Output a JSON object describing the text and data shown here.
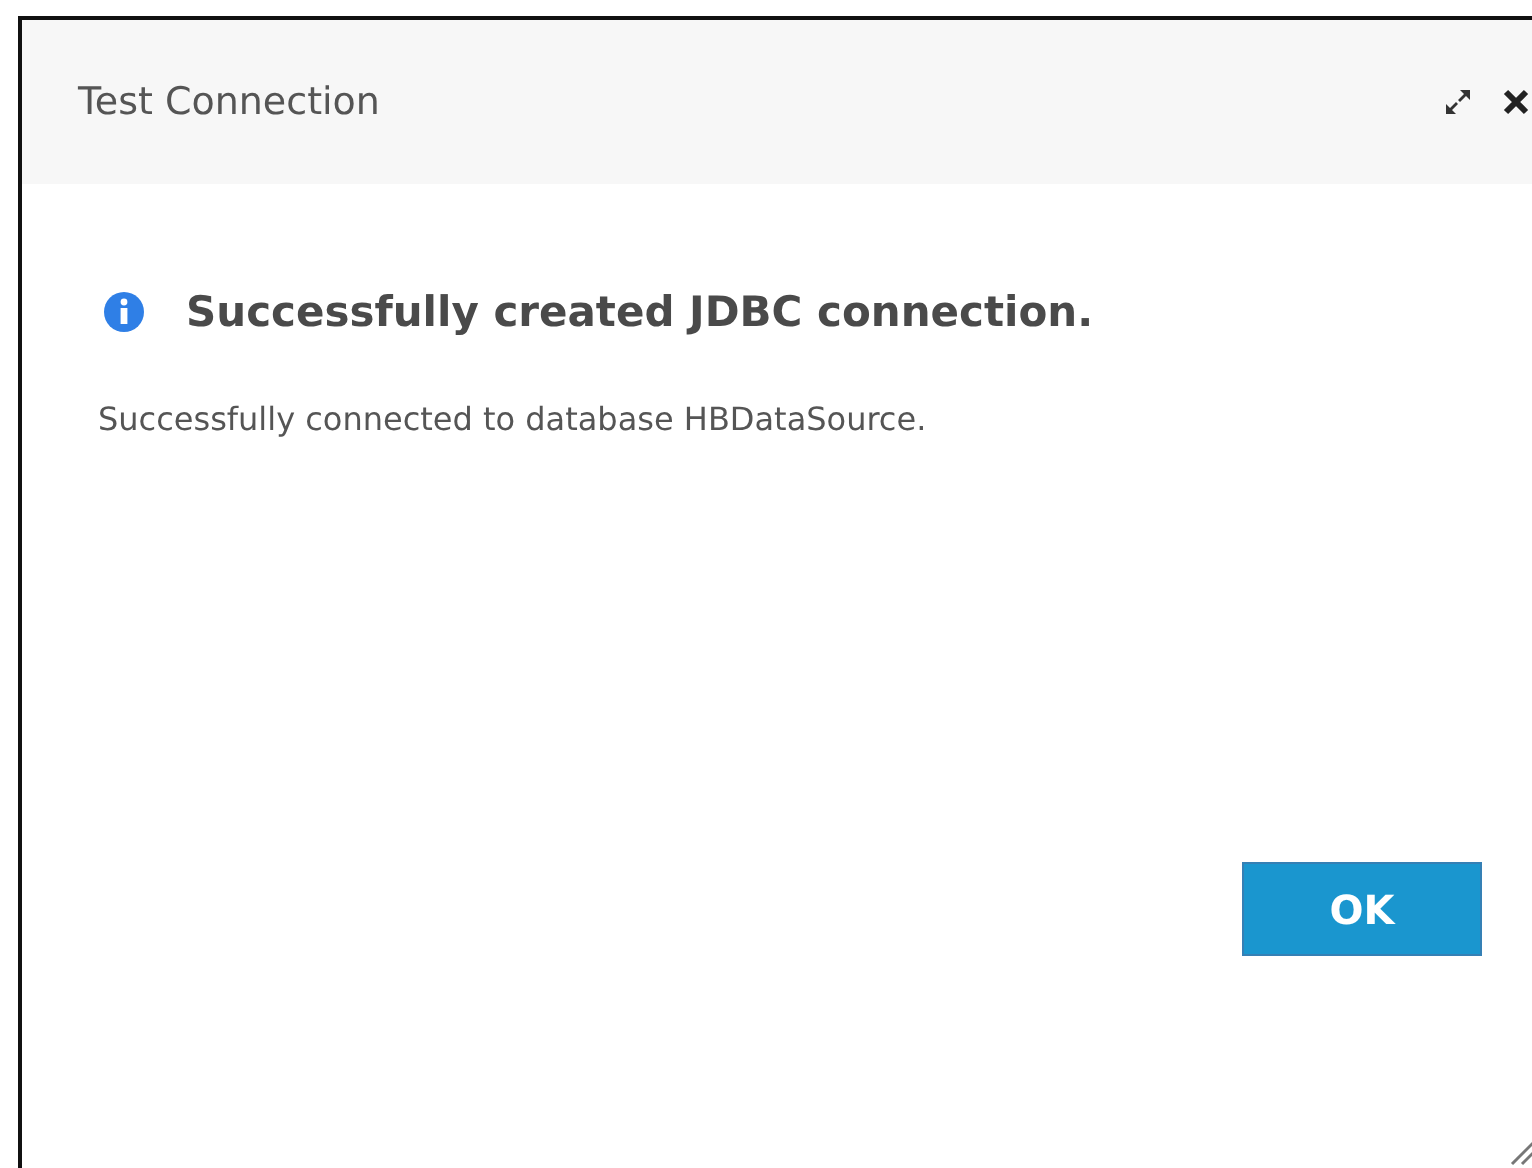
{
  "dialog": {
    "title": "Test Connection",
    "heading": "Successfully created JDBC connection.",
    "message": "Successfully connected to database HBDataSource.",
    "buttons": [
      {
        "label": "OK",
        "kind": "primary"
      }
    ]
  }
}
